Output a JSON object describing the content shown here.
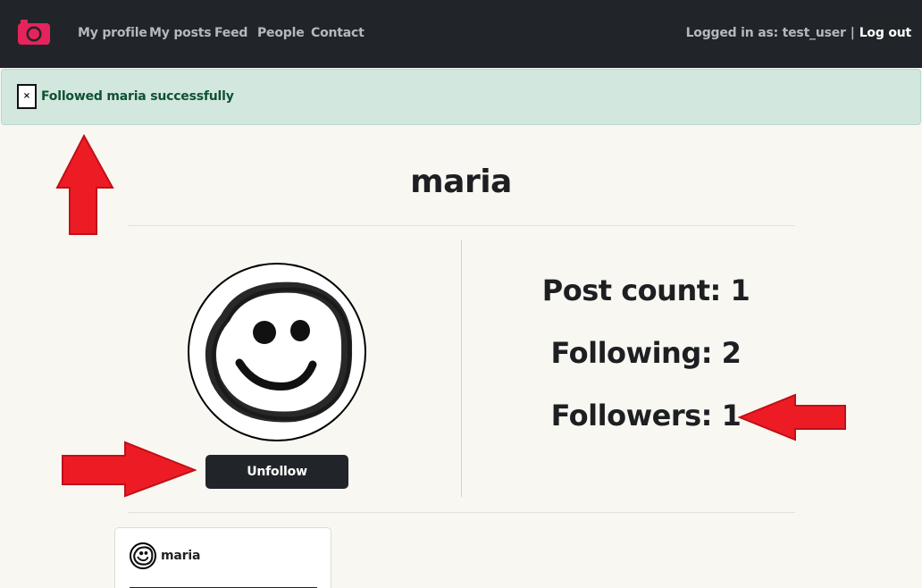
{
  "navbar": {
    "logo": "camera-icon",
    "links": [
      "My profile",
      "My posts",
      "Feed",
      "People",
      "Contact"
    ],
    "logged_in_text": "Logged in as: test_user",
    "separator": "|",
    "logout_label": "Log out"
  },
  "alert": {
    "close_label": "×",
    "message": "Followed maria successfully"
  },
  "profile": {
    "username": "maria",
    "avatar": "smiley-face-avatar",
    "unfollow_label": "Unfollow",
    "post_count": "Post count: 1",
    "following": "Following: 2",
    "followers": "Followers: 1"
  },
  "post": {
    "username": "maria",
    "avatar": "smiley-face-avatar"
  },
  "colors": {
    "navbar": "#212529",
    "accent_logo": "#e5245c",
    "alert_bg": "#d2e7dd",
    "alert_text": "#0f5132",
    "annotation_arrow": "#ed1c24",
    "page_bg": "#f8f7f2"
  }
}
